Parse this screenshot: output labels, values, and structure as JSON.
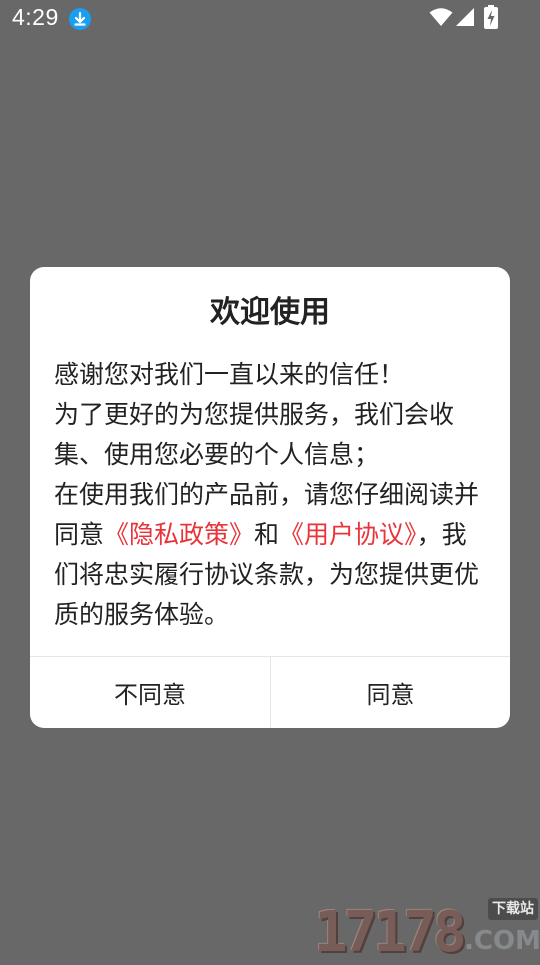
{
  "status_bar": {
    "time": "4:29",
    "icons": [
      "download-icon",
      "wifi-icon",
      "cell-signal-icon",
      "battery-charging-icon"
    ],
    "download_badge_color": "#1a9ff0"
  },
  "dialog": {
    "title": "欢迎使用",
    "paragraph1": "感谢您对我们一直以来的信任！",
    "paragraph2": "为了更好的为您提供服务，我们会收集、使用您必要的个人信息；",
    "paragraph3_before": "在使用我们的产品前，请您仔细阅读并同意",
    "privacy_link": "《隐私政策》",
    "and_text": "和",
    "user_agreement_link": "《用户协议》",
    "paragraph3_after": "，我们将忠实履行协议条款，为您提供更优质的服务体验。",
    "link_color": "#e8353b",
    "buttons": {
      "disagree": "不同意",
      "agree": "同意"
    }
  },
  "watermark": {
    "number": "17178",
    "domain": ".COM",
    "tag": "下载站"
  }
}
